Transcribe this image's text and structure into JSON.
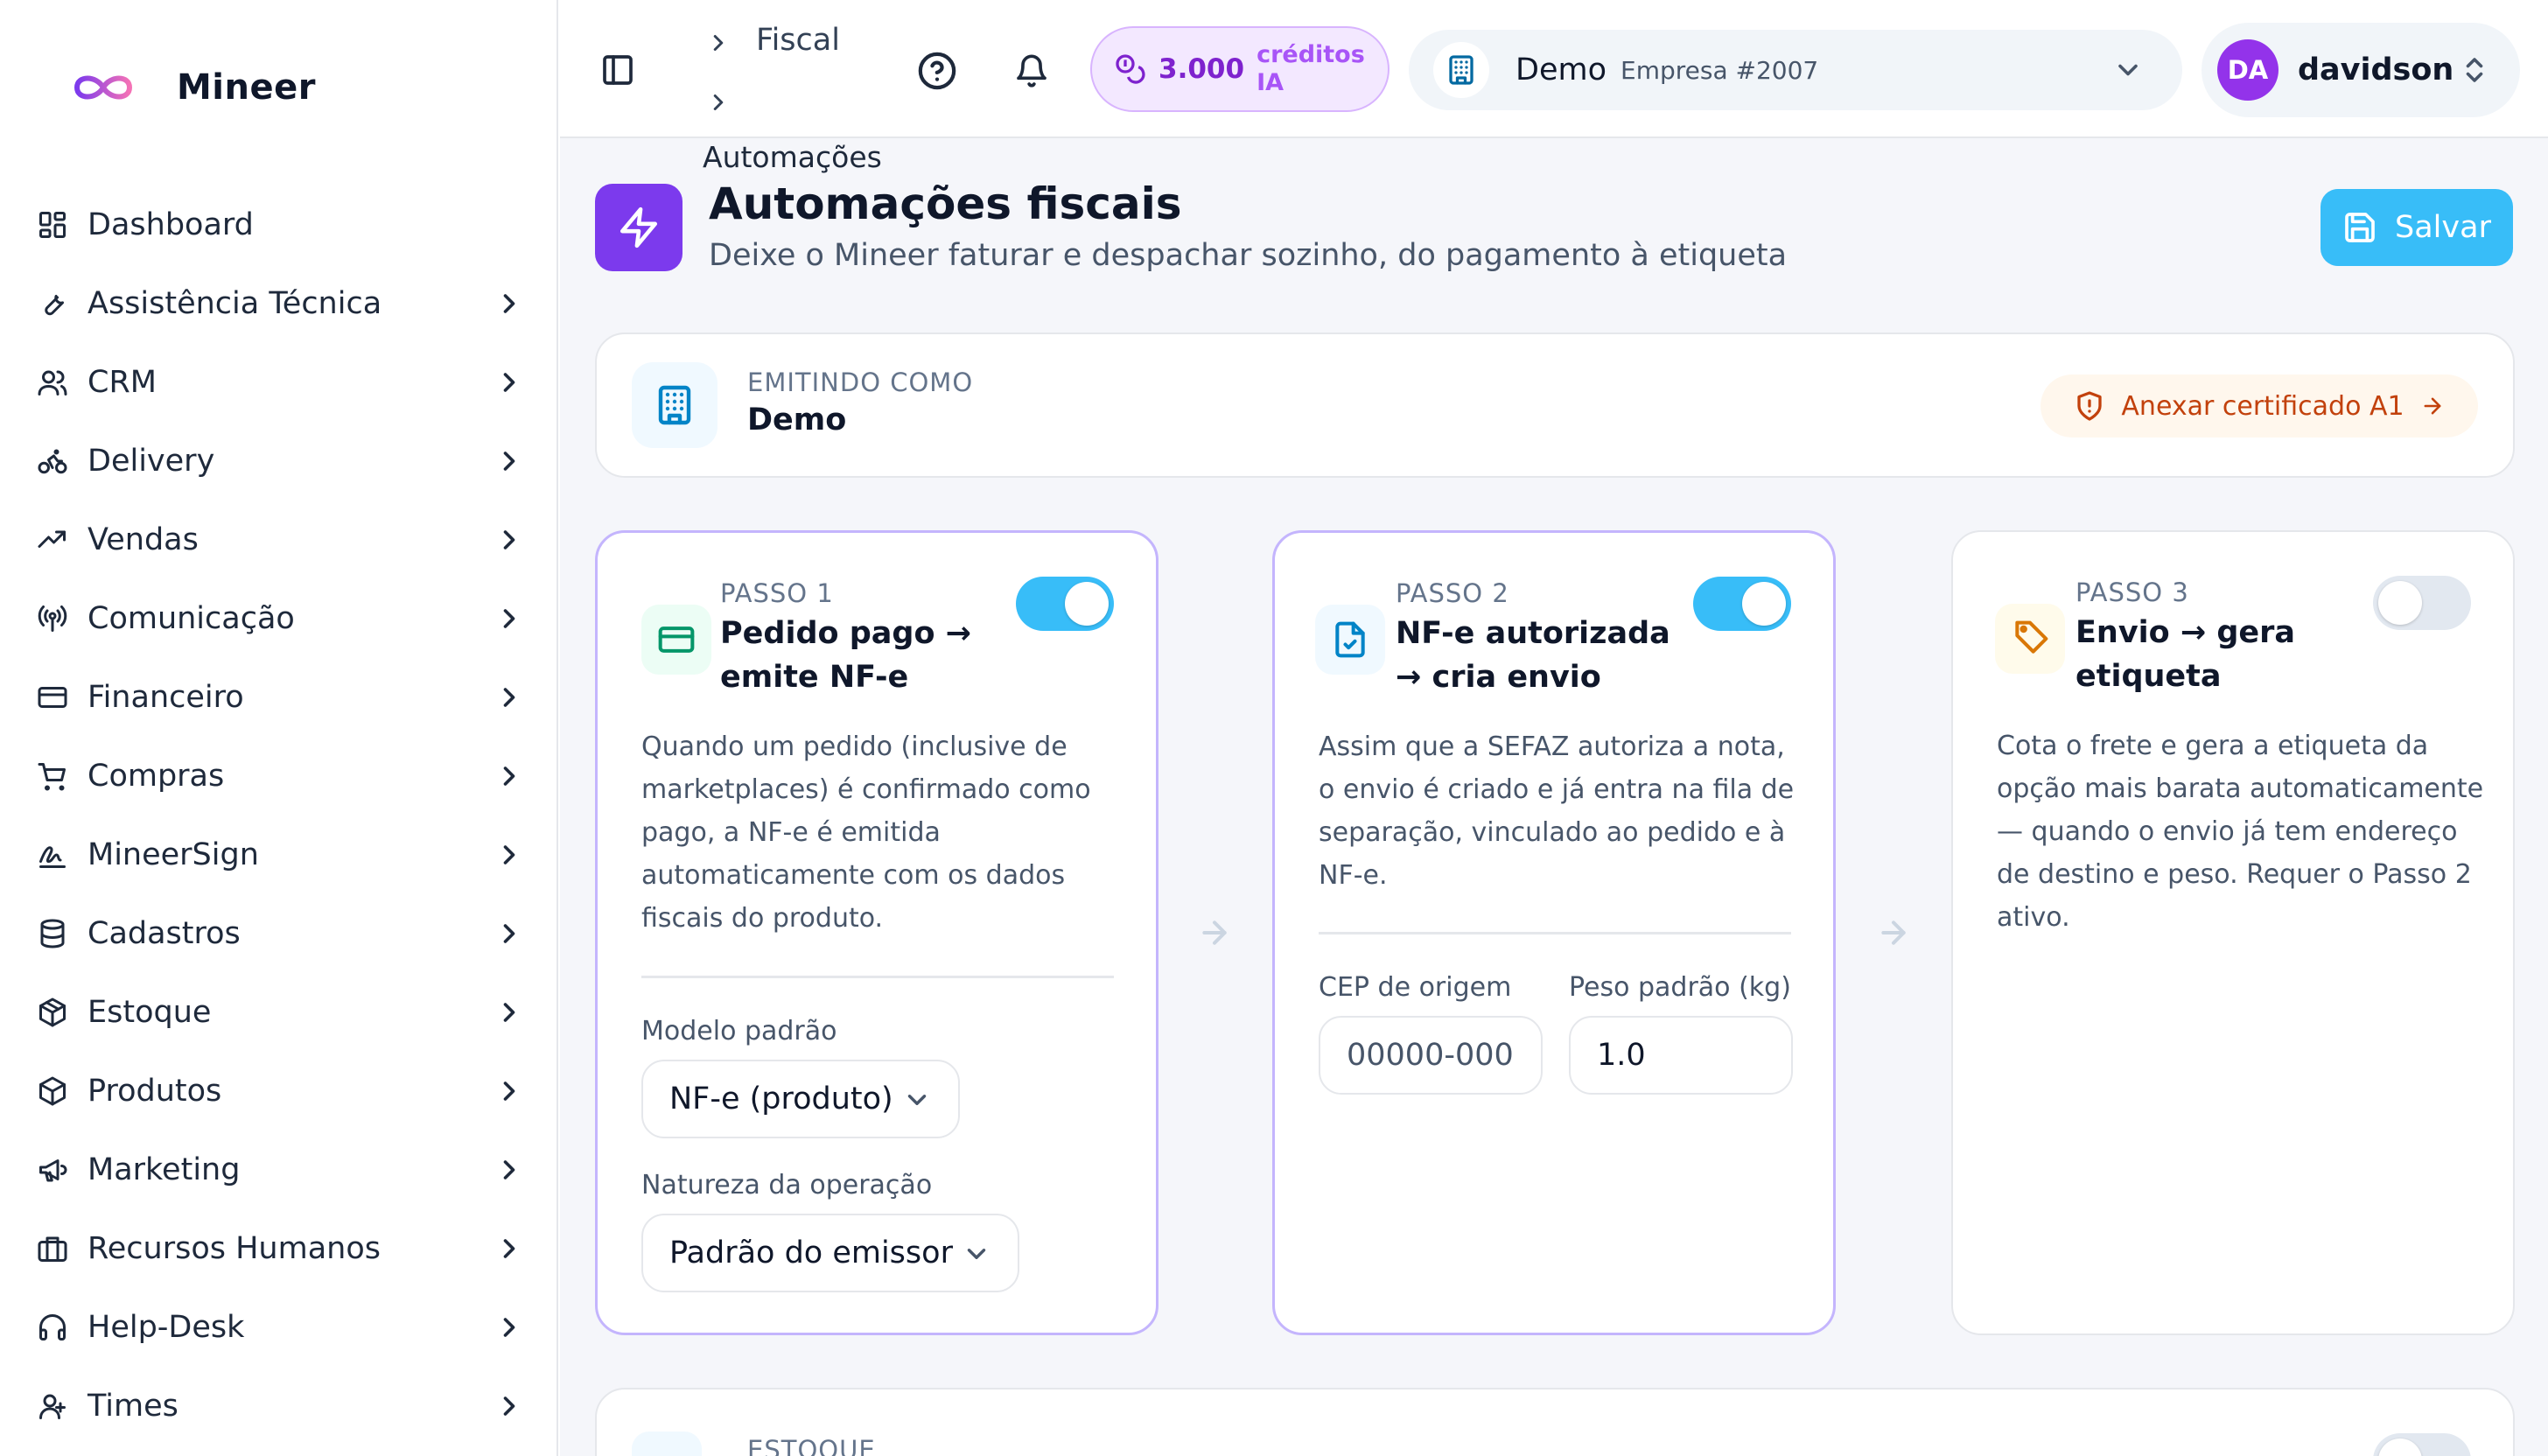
{
  "brand": {
    "name": "Mineer"
  },
  "sidebar": {
    "items": [
      {
        "label": "Dashboard",
        "icon": "dashboard-icon"
      },
      {
        "label": "Assistência Técnica",
        "icon": "wrench-icon"
      },
      {
        "label": "CRM",
        "icon": "users-icon"
      },
      {
        "label": "Delivery",
        "icon": "bike-icon"
      },
      {
        "label": "Vendas",
        "icon": "trending-up-icon"
      },
      {
        "label": "Comunicação",
        "icon": "radio-icon"
      },
      {
        "label": "Financeiro",
        "icon": "credit-card-icon"
      },
      {
        "label": "Compras",
        "icon": "cart-icon"
      },
      {
        "label": "MineerSign",
        "icon": "signature-icon"
      },
      {
        "label": "Cadastros",
        "icon": "database-icon"
      },
      {
        "label": "Estoque",
        "icon": "package-icon"
      },
      {
        "label": "Produtos",
        "icon": "box-icon"
      },
      {
        "label": "Marketing",
        "icon": "megaphone-icon"
      },
      {
        "label": "Recursos Humanos",
        "icon": "briefcase-icon"
      },
      {
        "label": "Help-Desk",
        "icon": "headphones-icon"
      },
      {
        "label": "Times",
        "icon": "team-icon"
      }
    ]
  },
  "topbar": {
    "breadcrumb": {
      "first": "Fiscal",
      "second": "Automações"
    },
    "credits": {
      "amount": "3.000",
      "label": "créditos IA"
    },
    "company": {
      "name": "Demo",
      "subtitle": "Empresa #2007"
    },
    "user": {
      "initials": "DA",
      "name": "davidson"
    }
  },
  "page": {
    "title": "Automações fiscais",
    "subtitle": "Deixe o Mineer faturar e despachar sozinho, do pagamento à etiqueta",
    "save_label": "Salvar"
  },
  "issuer": {
    "label": "EMITINDO COMO",
    "name": "Demo",
    "cert_button": "Anexar certificado A1"
  },
  "steps": [
    {
      "num": "PASSO 1",
      "title": "Pedido pago → emite NF-e",
      "enabled": true,
      "description": "Quando um pedido (inclusive de marketplaces) é confirmado como pago, a NF-e é emitida automaticamente com os dados fiscais do produto.",
      "fields": {
        "model_label": "Modelo padrão",
        "model_value": "NF-e (produto)",
        "nature_label": "Natureza da operação",
        "nature_value": "Padrão do emissor"
      }
    },
    {
      "num": "PASSO 2",
      "title": "NF-e autorizada → cria envio",
      "enabled": true,
      "description": "Assim que a SEFAZ autoriza a nota, o envio é criado e já entra na fila de separação, vinculado ao pedido e à NF-e.",
      "fields": {
        "cep_label": "CEP de origem",
        "cep_placeholder": "00000-000",
        "weight_label": "Peso padrão (kg)",
        "weight_value": "1.0"
      }
    },
    {
      "num": "PASSO 3",
      "title": "Envio → gera etiqueta",
      "enabled": false,
      "description": "Cota o frete e gera a etiqueta da opção mais barata automaticamente — quando o envio já tem endereço de destino e peso. Requer o Passo 2 ativo."
    }
  ],
  "stock_card": {
    "label": "ESTOQUE"
  },
  "colors": {
    "accent": "#38bdf8",
    "brand_purple": "#7c3aed",
    "cert_orange": "#c2410c"
  }
}
